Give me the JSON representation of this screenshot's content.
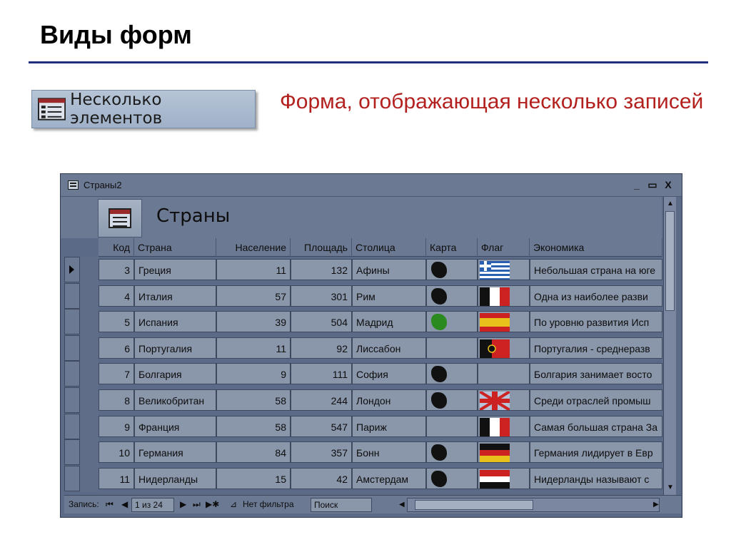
{
  "slide": {
    "title": "Виды форм",
    "badge_label": "Несколько элементов",
    "caption": "Форма, отображающая несколько записей"
  },
  "window": {
    "title": "Страны2",
    "minimize": "_",
    "restore": "▭",
    "close": "X",
    "form_title": "Страны"
  },
  "columns": [
    "Код",
    "Страна",
    "Население",
    "Площадь",
    "Столица",
    "Карта",
    "Флаг",
    "Экономика"
  ],
  "rows": [
    {
      "code": "3",
      "country": "Греция",
      "population": "11",
      "area": "132",
      "capital": "Афины",
      "map": "map-icon",
      "flag": "greece",
      "economy": "Небольшая страна на юге"
    },
    {
      "code": "4",
      "country": "Италия",
      "population": "57",
      "area": "301",
      "capital": "Рим",
      "map": "map-icon",
      "flag": "italy",
      "economy": "Одна из наиболее разви"
    },
    {
      "code": "5",
      "country": "Испания",
      "population": "39",
      "area": "504",
      "capital": "Мадрид",
      "map": "map-icon-green",
      "flag": "spain",
      "economy": "По уровню развития Исп"
    },
    {
      "code": "6",
      "country": "Португалия",
      "population": "11",
      "area": "92",
      "capital": "Лиссабон",
      "map": "",
      "flag": "portugal",
      "economy": "Португалия - среднеразв"
    },
    {
      "code": "7",
      "country": "Болгария",
      "population": "9",
      "area": "111",
      "capital": "София",
      "map": "map-icon",
      "flag": "",
      "economy": "Болгария занимает восто"
    },
    {
      "code": "8",
      "country": "Великобритан",
      "population": "58",
      "area": "244",
      "capital": "Лондон",
      "map": "map-icon",
      "flag": "uk",
      "economy": "Среди отраслей промыш"
    },
    {
      "code": "9",
      "country": "Франция",
      "population": "58",
      "area": "547",
      "capital": "Париж",
      "map": "",
      "flag": "france",
      "economy": "Самая большая страна За"
    },
    {
      "code": "10",
      "country": "Германия",
      "population": "84",
      "area": "357",
      "capital": "Бонн",
      "map": "map-icon",
      "flag": "germany",
      "economy": "Германия лидирует в Евр"
    },
    {
      "code": "11",
      "country": "Нидерланды",
      "population": "15",
      "area": "42",
      "capital": "Амстердам",
      "map": "map-icon",
      "flag": "netherlands",
      "economy": "Нидерланды называют с"
    }
  ],
  "navigation": {
    "records_label": "Запись:",
    "first": "⏮",
    "prev": "◀",
    "position": "1 из 24",
    "next": "▶",
    "last": "⏭",
    "new": "▶✱",
    "filter_label": "Нет фильтра",
    "search_label": "Поиск"
  }
}
